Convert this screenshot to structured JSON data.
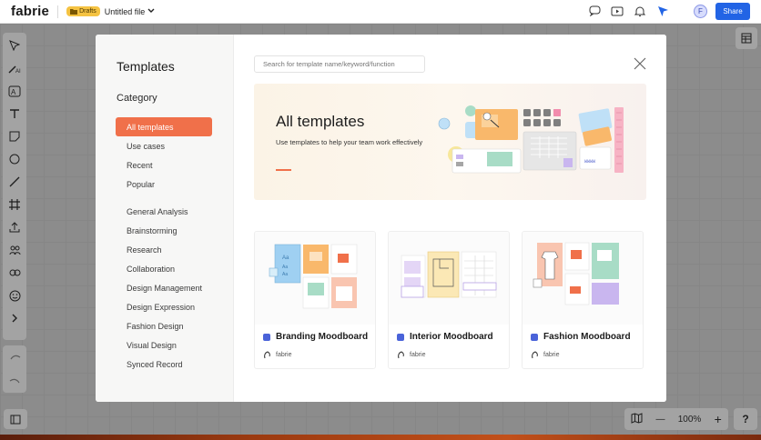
{
  "app": {
    "logo": "fabrie",
    "badge": "Drafts",
    "filename": "Untitled file",
    "avatar_initial": "F",
    "share_label": "Share"
  },
  "zoom": {
    "level": "100%",
    "minus": "—",
    "plus": "+"
  },
  "help_label": "?",
  "modal": {
    "title": "Templates",
    "category_title": "Category",
    "categories_primary": [
      "All templates",
      "Use cases",
      "Recent",
      "Popular"
    ],
    "categories_secondary": [
      "General Analysis",
      "Brainstorming",
      "Research",
      "Collaboration",
      "Design Management",
      "Design Expression",
      "Fashion Design",
      "Visual Design",
      "Synced Record"
    ],
    "active_category": "All templates",
    "search_placeholder": "Search for template name/keyword/function",
    "hero_title": "All templates",
    "hero_subtitle": "Use templates to help your team work effectively",
    "cards": [
      {
        "title": "Branding Moodboard",
        "author": "fabrie"
      },
      {
        "title": "Interior Moodboard",
        "author": "fabrie"
      },
      {
        "title": "Fashion Moodboard",
        "author": "fabrie"
      }
    ]
  },
  "colors": {
    "accent": "#f0704a",
    "share": "#2264e5",
    "badge": "#f5c342"
  },
  "icons": {
    "top": [
      "comment-icon",
      "present-icon",
      "bell-icon",
      "cursor-follow-icon"
    ],
    "left_tools": [
      "select-icon",
      "ai-icon",
      "ai-text-icon",
      "text-icon",
      "sticky-note-icon",
      "circle-icon",
      "line-icon",
      "frame-icon",
      "upload-icon",
      "team-icon",
      "link-icon",
      "emoji-icon",
      "more-icon"
    ]
  }
}
